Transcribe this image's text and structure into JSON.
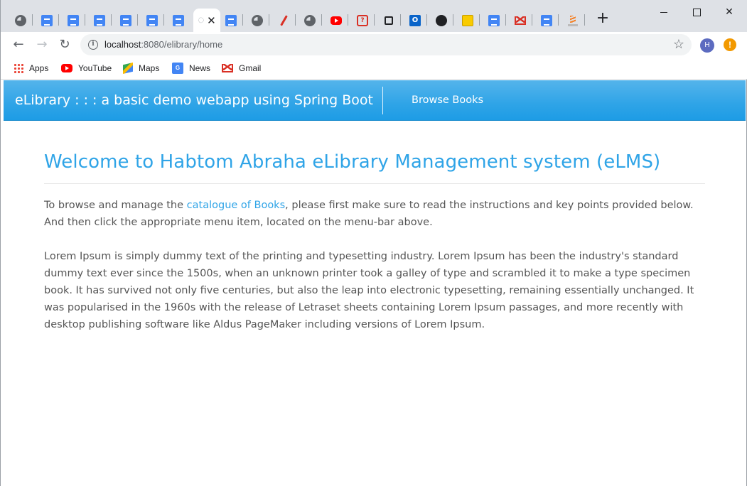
{
  "browser": {
    "tabs": [
      {
        "icon": "globe-icon"
      },
      {
        "icon": "docs-icon"
      },
      {
        "icon": "docs-icon"
      },
      {
        "icon": "docs-icon"
      },
      {
        "icon": "docs-icon"
      },
      {
        "icon": "docs-icon"
      },
      {
        "icon": "docs-icon"
      },
      {
        "icon": "loading-icon",
        "active": true
      },
      {
        "icon": "docs-icon"
      },
      {
        "icon": "globe-icon"
      },
      {
        "icon": "pen-icon"
      },
      {
        "icon": "globe-icon"
      },
      {
        "icon": "youtube-icon"
      },
      {
        "icon": "question-icon"
      },
      {
        "icon": "square-icon"
      },
      {
        "icon": "outlook-icon"
      },
      {
        "icon": "github-icon"
      },
      {
        "icon": "keep-icon"
      },
      {
        "icon": "docs-icon"
      },
      {
        "icon": "gmail-icon"
      },
      {
        "icon": "docs-icon"
      },
      {
        "icon": "stackoverflow-icon"
      }
    ],
    "new_tab_label": "+",
    "close_tab_label": "✕",
    "window_controls": {
      "close": "✕"
    },
    "address_bar": {
      "host": "localhost",
      "path": ":8080/elibrary/home"
    },
    "profile_initial": "H",
    "alert_label": "!",
    "bookmarks": [
      {
        "label": "Apps",
        "icon": "apps-grid-icon"
      },
      {
        "label": "YouTube",
        "icon": "youtube-icon"
      },
      {
        "label": "Maps",
        "icon": "maps-icon"
      },
      {
        "label": "News",
        "icon": "news-icon"
      },
      {
        "label": "Gmail",
        "icon": "gmail-icon"
      }
    ]
  },
  "app": {
    "brand": "eLibrary : : : a basic demo webapp using Spring Boot",
    "nav_link": "Browse Books",
    "title": "Welcome to Habtom Abraha eLibrary Management system (eLMS)",
    "intro_before": "To browse and manage the ",
    "intro_link": "catalogue of Books",
    "intro_after": ", please first make sure to read the instructions and key points provided below. And then click the appropriate menu item, located on the menu-bar above.",
    "lorem": "Lorem Ipsum is simply dummy text of the printing and typesetting industry. Lorem Ipsum has been the industry's standard dummy text ever since the 1500s, when an unknown printer took a galley of type and scrambled it to make a type specimen book. It has survived not only five centuries, but also the leap into electronic typesetting, remaining essentially unchanged. It was popularised in the 1960s with the release of Letraset sheets containing Lorem Ipsum passages, and more recently with desktop publishing software like Aldus PageMaker including versions of Lorem Ipsum."
  },
  "colors": {
    "primary": "#2fa4e7",
    "text": "#555555",
    "tabstrip": "#dee1e6"
  }
}
